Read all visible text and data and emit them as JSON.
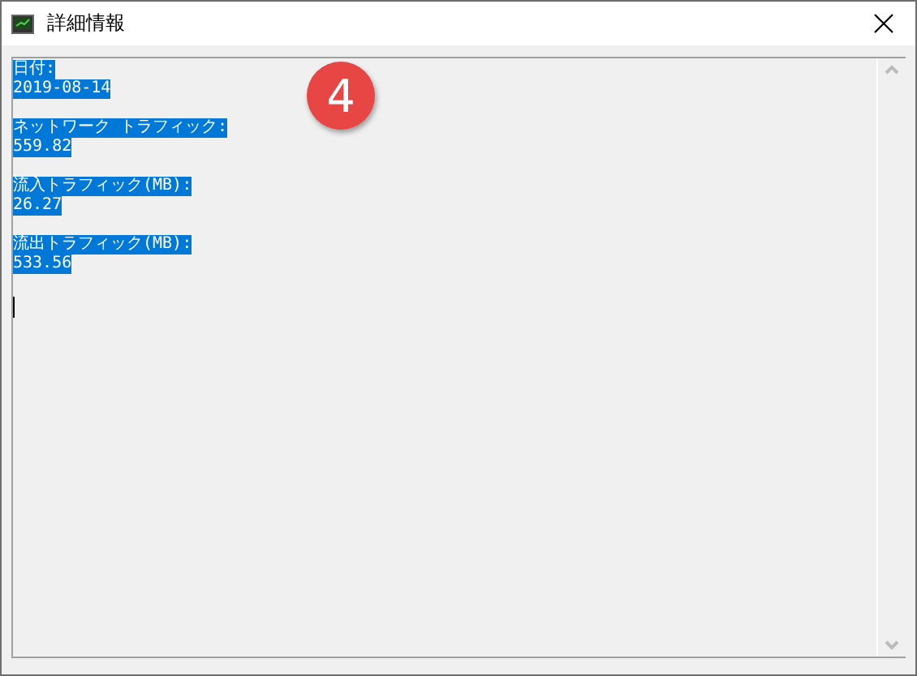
{
  "window": {
    "title": "詳細情報"
  },
  "content": {
    "entries": [
      {
        "label": "日付:",
        "value": "2019-08-14"
      },
      {
        "label": "ネットワーク トラフィック:",
        "value": "559.82"
      },
      {
        "label": "流入トラフィック(MB):",
        "value": "26.27"
      },
      {
        "label": "流出トラフィック(MB):",
        "value": "533.56"
      }
    ]
  },
  "badge": "4"
}
